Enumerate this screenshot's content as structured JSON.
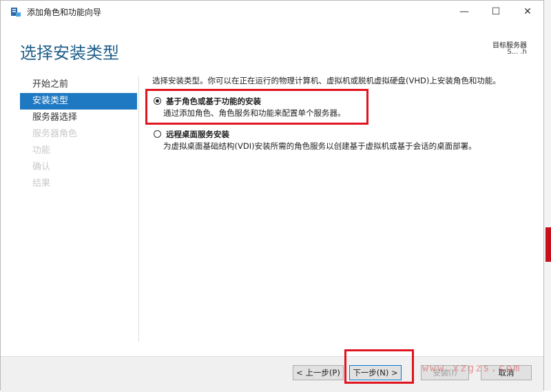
{
  "window": {
    "title": "添加角色和功能向导",
    "minimize_icon": "minimize-icon",
    "maximize_icon": "maximize-icon",
    "close_icon": "close-icon"
  },
  "header": {
    "page_title": "选择安装类型",
    "target_label": "目标服务器",
    "target_value": "S... .h"
  },
  "nav": {
    "items": [
      {
        "label": "开始之前",
        "state": "normal"
      },
      {
        "label": "安装类型",
        "state": "selected"
      },
      {
        "label": "服务器选择",
        "state": "normal"
      },
      {
        "label": "服务器角色",
        "state": "disabled"
      },
      {
        "label": "功能",
        "state": "disabled"
      },
      {
        "label": "确认",
        "state": "disabled"
      },
      {
        "label": "结果",
        "state": "disabled"
      }
    ]
  },
  "content": {
    "instruction": "选择安装类型。你可以在正在运行的物理计算机、虚拟机或脱机虚拟硬盘(VHD)上安装角色和功能。",
    "options": [
      {
        "label": "基于角色或基于功能的安装",
        "description": "通过添加角色、角色服务和功能来配置单个服务器。",
        "checked": true
      },
      {
        "label": "远程桌面服务安装",
        "description": "为虚拟桌面基础结构(VDI)安装所需的角色服务以创建基于虚拟机或基于会话的桌面部署。",
        "checked": false
      }
    ]
  },
  "footer": {
    "prev_label": "< 上一步(P)",
    "next_label": "下一步(N) >",
    "install_label": "安装(I)",
    "cancel_label": "取消"
  },
  "watermark": "www.xzgzs.com",
  "colors": {
    "accent": "#1f79c2",
    "title": "#1f5f8b",
    "highlight": "#e0131e"
  }
}
